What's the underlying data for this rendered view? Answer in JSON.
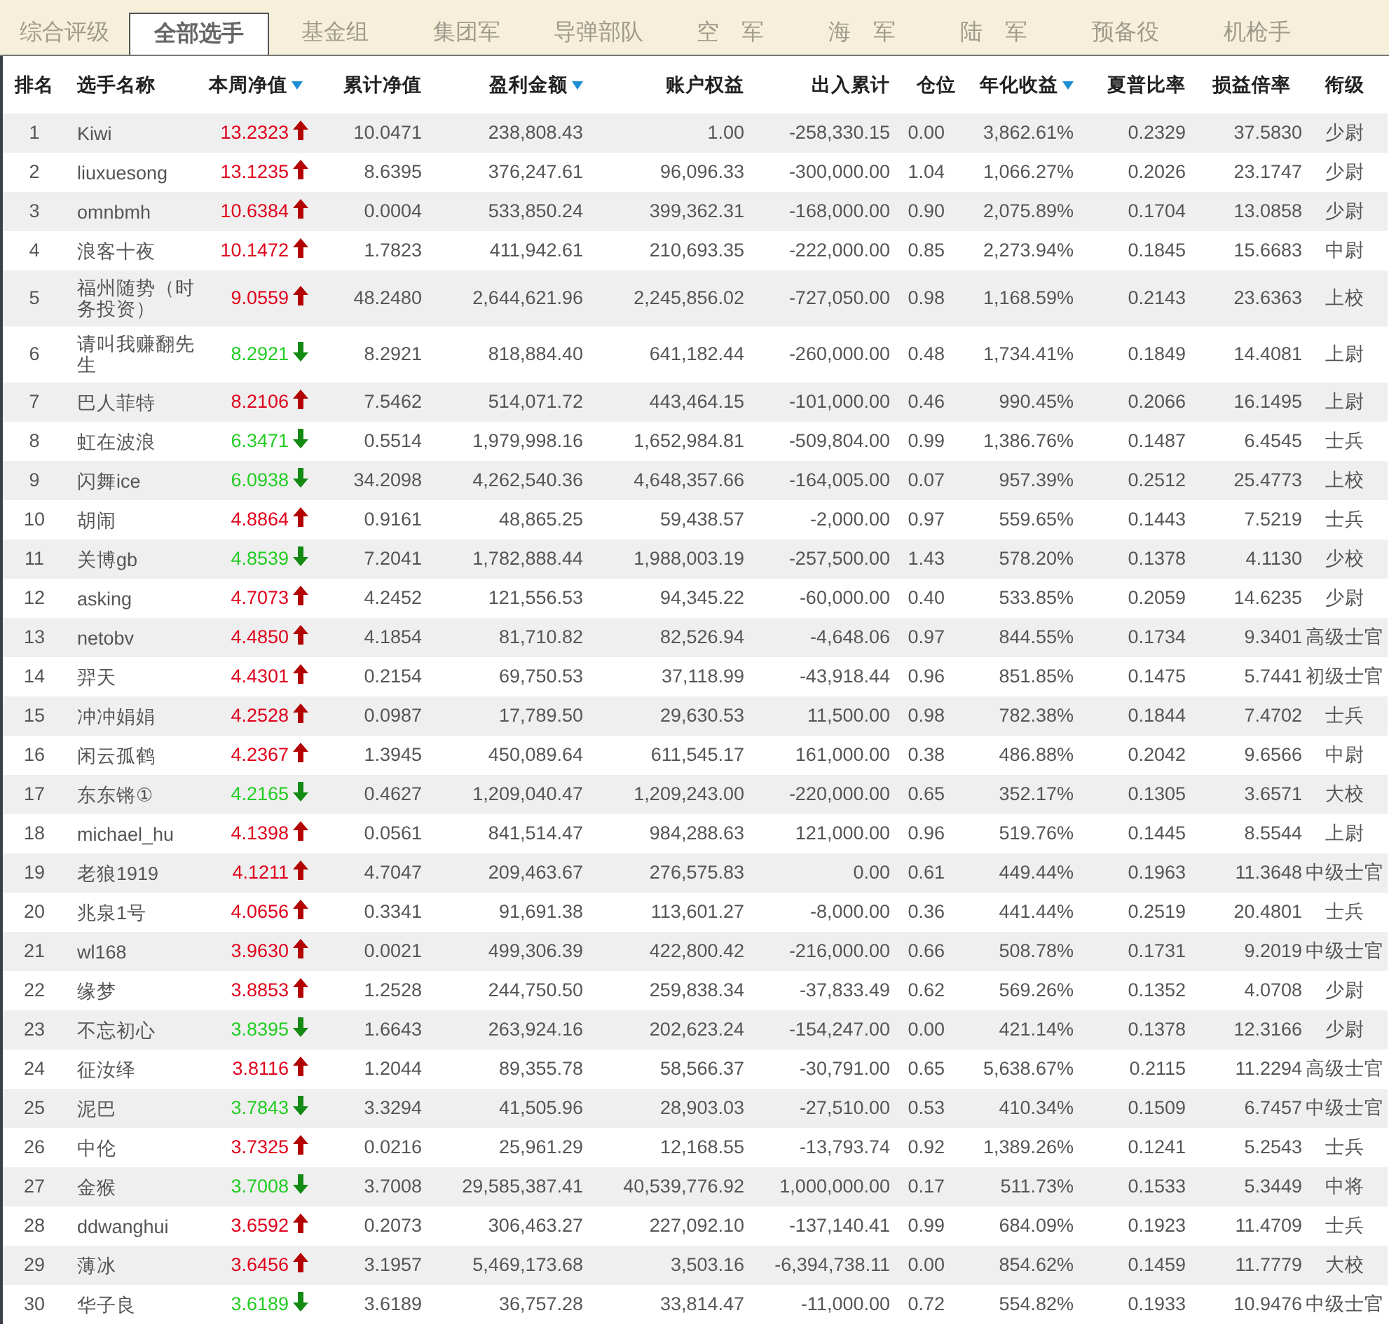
{
  "tabs": [
    {
      "label": "综合评级",
      "selected": false
    },
    {
      "label": "全部选手",
      "selected": true
    },
    {
      "label": "基金组",
      "selected": false
    },
    {
      "label": "集团军",
      "selected": false
    },
    {
      "label": "导弹部队",
      "selected": false
    },
    {
      "label": "空　军",
      "selected": false
    },
    {
      "label": "海　军",
      "selected": false
    },
    {
      "label": "陆　军",
      "selected": false
    },
    {
      "label": "预备役",
      "selected": false
    },
    {
      "label": "机枪手",
      "selected": false
    }
  ],
  "table": {
    "columns": [
      {
        "label": "排名",
        "sortable": false
      },
      {
        "label": "选手名称",
        "sortable": false
      },
      {
        "label": "本周净值",
        "sortable": true
      },
      {
        "label": "累计净值",
        "sortable": false
      },
      {
        "label": "盈利金额",
        "sortable": true
      },
      {
        "label": "账户权益",
        "sortable": false
      },
      {
        "label": "出入累计",
        "sortable": false
      },
      {
        "label": "仓位",
        "sortable": false
      },
      {
        "label": "年化收益",
        "sortable": true
      },
      {
        "label": "夏普比率",
        "sortable": false
      },
      {
        "label": "损益倍率",
        "sortable": false
      },
      {
        "label": "衔级",
        "sortable": false
      }
    ],
    "rows": [
      {
        "rising": true,
        "cells": [
          "1",
          "Kiwi",
          "13.2323",
          "10.0471",
          "238,808.43",
          "1.00",
          "-258,330.15",
          "0.00",
          "3,862.61%",
          "0.2329",
          "37.5830",
          "少尉"
        ]
      },
      {
        "rising": true,
        "cells": [
          "2",
          "liuxuesong",
          "13.1235",
          "8.6395",
          "376,247.61",
          "96,096.33",
          "-300,000.00",
          "1.04",
          "1,066.27%",
          "0.2026",
          "23.1747",
          "少尉"
        ]
      },
      {
        "rising": true,
        "cells": [
          "3",
          "omnbmh",
          "10.6384",
          "0.0004",
          "533,850.24",
          "399,362.31",
          "-168,000.00",
          "0.90",
          "2,075.89%",
          "0.1704",
          "13.0858",
          "少尉"
        ]
      },
      {
        "rising": true,
        "cells": [
          "4",
          "浪客十夜",
          "10.1472",
          "1.7823",
          "411,942.61",
          "210,693.35",
          "-222,000.00",
          "0.85",
          "2,273.94%",
          "0.1845",
          "15.6683",
          "中尉"
        ]
      },
      {
        "rising": true,
        "cells": [
          "5",
          "福州随势（时务投资）",
          "9.0559",
          "48.2480",
          "2,644,621.96",
          "2,245,856.02",
          "-727,050.00",
          "0.98",
          "1,168.59%",
          "0.2143",
          "23.6363",
          "上校"
        ]
      },
      {
        "rising": false,
        "cells": [
          "6",
          "请叫我赚翻先生",
          "8.2921",
          "8.2921",
          "818,884.40",
          "641,182.44",
          "-260,000.00",
          "0.48",
          "1,734.41%",
          "0.1849",
          "14.4081",
          "上尉"
        ]
      },
      {
        "rising": true,
        "cells": [
          "7",
          "巴人菲特",
          "8.2106",
          "7.5462",
          "514,071.72",
          "443,464.15",
          "-101,000.00",
          "0.46",
          "990.45%",
          "0.2066",
          "16.1495",
          "上尉"
        ]
      },
      {
        "rising": false,
        "cells": [
          "8",
          "虹在波浪",
          "6.3471",
          "0.5514",
          "1,979,998.16",
          "1,652,984.81",
          "-509,804.00",
          "0.99",
          "1,386.76%",
          "0.1487",
          "6.4545",
          "士兵"
        ]
      },
      {
        "rising": false,
        "cells": [
          "9",
          "闪舞ice",
          "6.0938",
          "34.2098",
          "4,262,540.36",
          "4,648,357.66",
          "-164,005.00",
          "0.07",
          "957.39%",
          "0.2512",
          "25.4773",
          "上校"
        ]
      },
      {
        "rising": true,
        "cells": [
          "10",
          "胡闹",
          "4.8864",
          "0.9161",
          "48,865.25",
          "59,438.57",
          "-2,000.00",
          "0.97",
          "559.65%",
          "0.1443",
          "7.5219",
          "士兵"
        ]
      },
      {
        "rising": false,
        "cells": [
          "11",
          "关博gb",
          "4.8539",
          "7.2041",
          "1,782,888.44",
          "1,988,003.19",
          "-257,500.00",
          "1.43",
          "578.20%",
          "0.1378",
          "4.1130",
          "少校"
        ]
      },
      {
        "rising": true,
        "cells": [
          "12",
          "asking",
          "4.7073",
          "4.2452",
          "121,556.53",
          "94,345.22",
          "-60,000.00",
          "0.40",
          "533.85%",
          "0.2059",
          "14.6235",
          "少尉"
        ]
      },
      {
        "rising": true,
        "cells": [
          "13",
          "netobv",
          "4.4850",
          "4.1854",
          "81,710.82",
          "82,526.94",
          "-4,648.06",
          "0.97",
          "844.55%",
          "0.1734",
          "9.3401",
          "高级士官"
        ]
      },
      {
        "rising": true,
        "cells": [
          "14",
          "羿天",
          "4.4301",
          "0.2154",
          "69,750.53",
          "37,118.99",
          "-43,918.44",
          "0.96",
          "851.85%",
          "0.1475",
          "5.7441",
          "初级士官"
        ]
      },
      {
        "rising": true,
        "cells": [
          "15",
          "冲冲娟娟",
          "4.2528",
          "0.0987",
          "17,789.50",
          "29,630.53",
          "11,500.00",
          "0.98",
          "782.38%",
          "0.1844",
          "7.4702",
          "士兵"
        ]
      },
      {
        "rising": true,
        "cells": [
          "16",
          "闲云孤鹤",
          "4.2367",
          "1.3945",
          "450,089.64",
          "611,545.17",
          "161,000.00",
          "0.38",
          "486.88%",
          "0.2042",
          "9.6566",
          "中尉"
        ]
      },
      {
        "rising": false,
        "cells": [
          "17",
          "东东锵①",
          "4.2165",
          "0.4627",
          "1,209,040.47",
          "1,209,243.00",
          "-220,000.00",
          "0.65",
          "352.17%",
          "0.1305",
          "3.6571",
          "大校"
        ]
      },
      {
        "rising": true,
        "cells": [
          "18",
          "michael_hu",
          "4.1398",
          "0.0561",
          "841,514.47",
          "984,288.63",
          "121,000.00",
          "0.96",
          "519.76%",
          "0.1445",
          "8.5544",
          "上尉"
        ]
      },
      {
        "rising": true,
        "cells": [
          "19",
          "老狼1919",
          "4.1211",
          "4.7047",
          "209,463.67",
          "276,575.83",
          "0.00",
          "0.61",
          "449.44%",
          "0.1963",
          "11.3648",
          "中级士官"
        ]
      },
      {
        "rising": true,
        "cells": [
          "20",
          "兆泉1号",
          "4.0656",
          "0.3341",
          "91,691.38",
          "113,601.27",
          "-8,000.00",
          "0.36",
          "441.44%",
          "0.2519",
          "20.4801",
          "士兵"
        ]
      },
      {
        "rising": true,
        "cells": [
          "21",
          "wl168",
          "3.9630",
          "0.0021",
          "499,306.39",
          "422,800.42",
          "-216,000.00",
          "0.66",
          "508.78%",
          "0.1731",
          "9.2019",
          "中级士官"
        ]
      },
      {
        "rising": true,
        "cells": [
          "22",
          "缘梦",
          "3.8853",
          "1.2528",
          "244,750.50",
          "259,838.34",
          "-37,833.49",
          "0.62",
          "569.26%",
          "0.1352",
          "4.0708",
          "少尉"
        ]
      },
      {
        "rising": false,
        "cells": [
          "23",
          "不忘初心",
          "3.8395",
          "1.6643",
          "263,924.16",
          "202,623.24",
          "-154,247.00",
          "0.00",
          "421.14%",
          "0.1378",
          "12.3166",
          "少尉"
        ]
      },
      {
        "rising": true,
        "cells": [
          "24",
          "征汝绎",
          "3.8116",
          "1.2044",
          "89,355.78",
          "58,566.37",
          "-30,791.00",
          "0.65",
          "5,638.67%",
          "0.2115",
          "11.2294",
          "高级士官"
        ]
      },
      {
        "rising": false,
        "cells": [
          "25",
          "泥巴",
          "3.7843",
          "3.3294",
          "41,505.96",
          "28,903.03",
          "-27,510.00",
          "0.53",
          "410.34%",
          "0.1509",
          "6.7457",
          "中级士官"
        ]
      },
      {
        "rising": true,
        "cells": [
          "26",
          "中伦",
          "3.7325",
          "0.0216",
          "25,961.29",
          "12,168.55",
          "-13,793.74",
          "0.92",
          "1,389.26%",
          "0.1241",
          "5.2543",
          "士兵"
        ]
      },
      {
        "rising": false,
        "cells": [
          "27",
          "金猴",
          "3.7008",
          "3.7008",
          "29,585,387.41",
          "40,539,776.92",
          "1,000,000.00",
          "0.17",
          "511.73%",
          "0.1533",
          "5.3449",
          "中将"
        ]
      },
      {
        "rising": true,
        "cells": [
          "28",
          "ddwanghui",
          "3.6592",
          "0.2073",
          "306,463.27",
          "227,092.10",
          "-137,140.41",
          "0.99",
          "684.09%",
          "0.1923",
          "11.4709",
          "士兵"
        ]
      },
      {
        "rising": true,
        "cells": [
          "29",
          "薄冰",
          "3.6456",
          "3.1957",
          "5,469,173.68",
          "3,503.16",
          "-6,394,738.11",
          "0.00",
          "854.62%",
          "0.1459",
          "11.7779",
          "大校"
        ]
      },
      {
        "rising": false,
        "cells": [
          "30",
          "华子良",
          "3.6189",
          "3.6189",
          "36,757.28",
          "33,814.47",
          "-11,000.00",
          "0.72",
          "554.82%",
          "0.1933",
          "10.9476",
          "中级士官"
        ]
      }
    ]
  }
}
